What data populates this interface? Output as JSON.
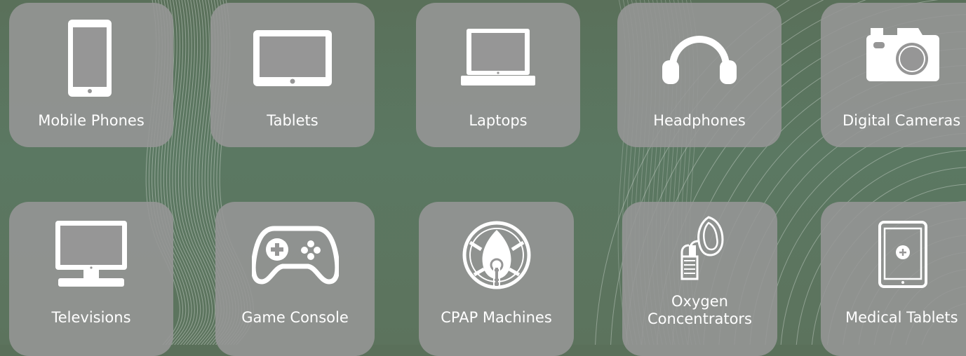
{
  "tiles": [
    {
      "label": "Mobile Phones",
      "icon": "mobile-phone-icon"
    },
    {
      "label": "Tablets",
      "icon": "tablet-icon"
    },
    {
      "label": "Laptops",
      "icon": "laptop-icon"
    },
    {
      "label": "Headphones",
      "icon": "headphones-icon"
    },
    {
      "label": "Digital Cameras",
      "icon": "camera-icon"
    },
    {
      "label": "Televisions",
      "icon": "television-icon"
    },
    {
      "label": "Game Console",
      "icon": "game-controller-icon"
    },
    {
      "label": "CPAP Machines",
      "icon": "cpap-mask-icon"
    },
    {
      "label": "Oxygen\nConcentrators",
      "icon": "oxygen-mask-icon"
    },
    {
      "label": "Medical Tablets",
      "icon": "medical-tablet-icon"
    }
  ],
  "colors": {
    "background": "#5b7862",
    "tile": "#969696",
    "icon": "#ffffff",
    "label": "#ffffff"
  }
}
